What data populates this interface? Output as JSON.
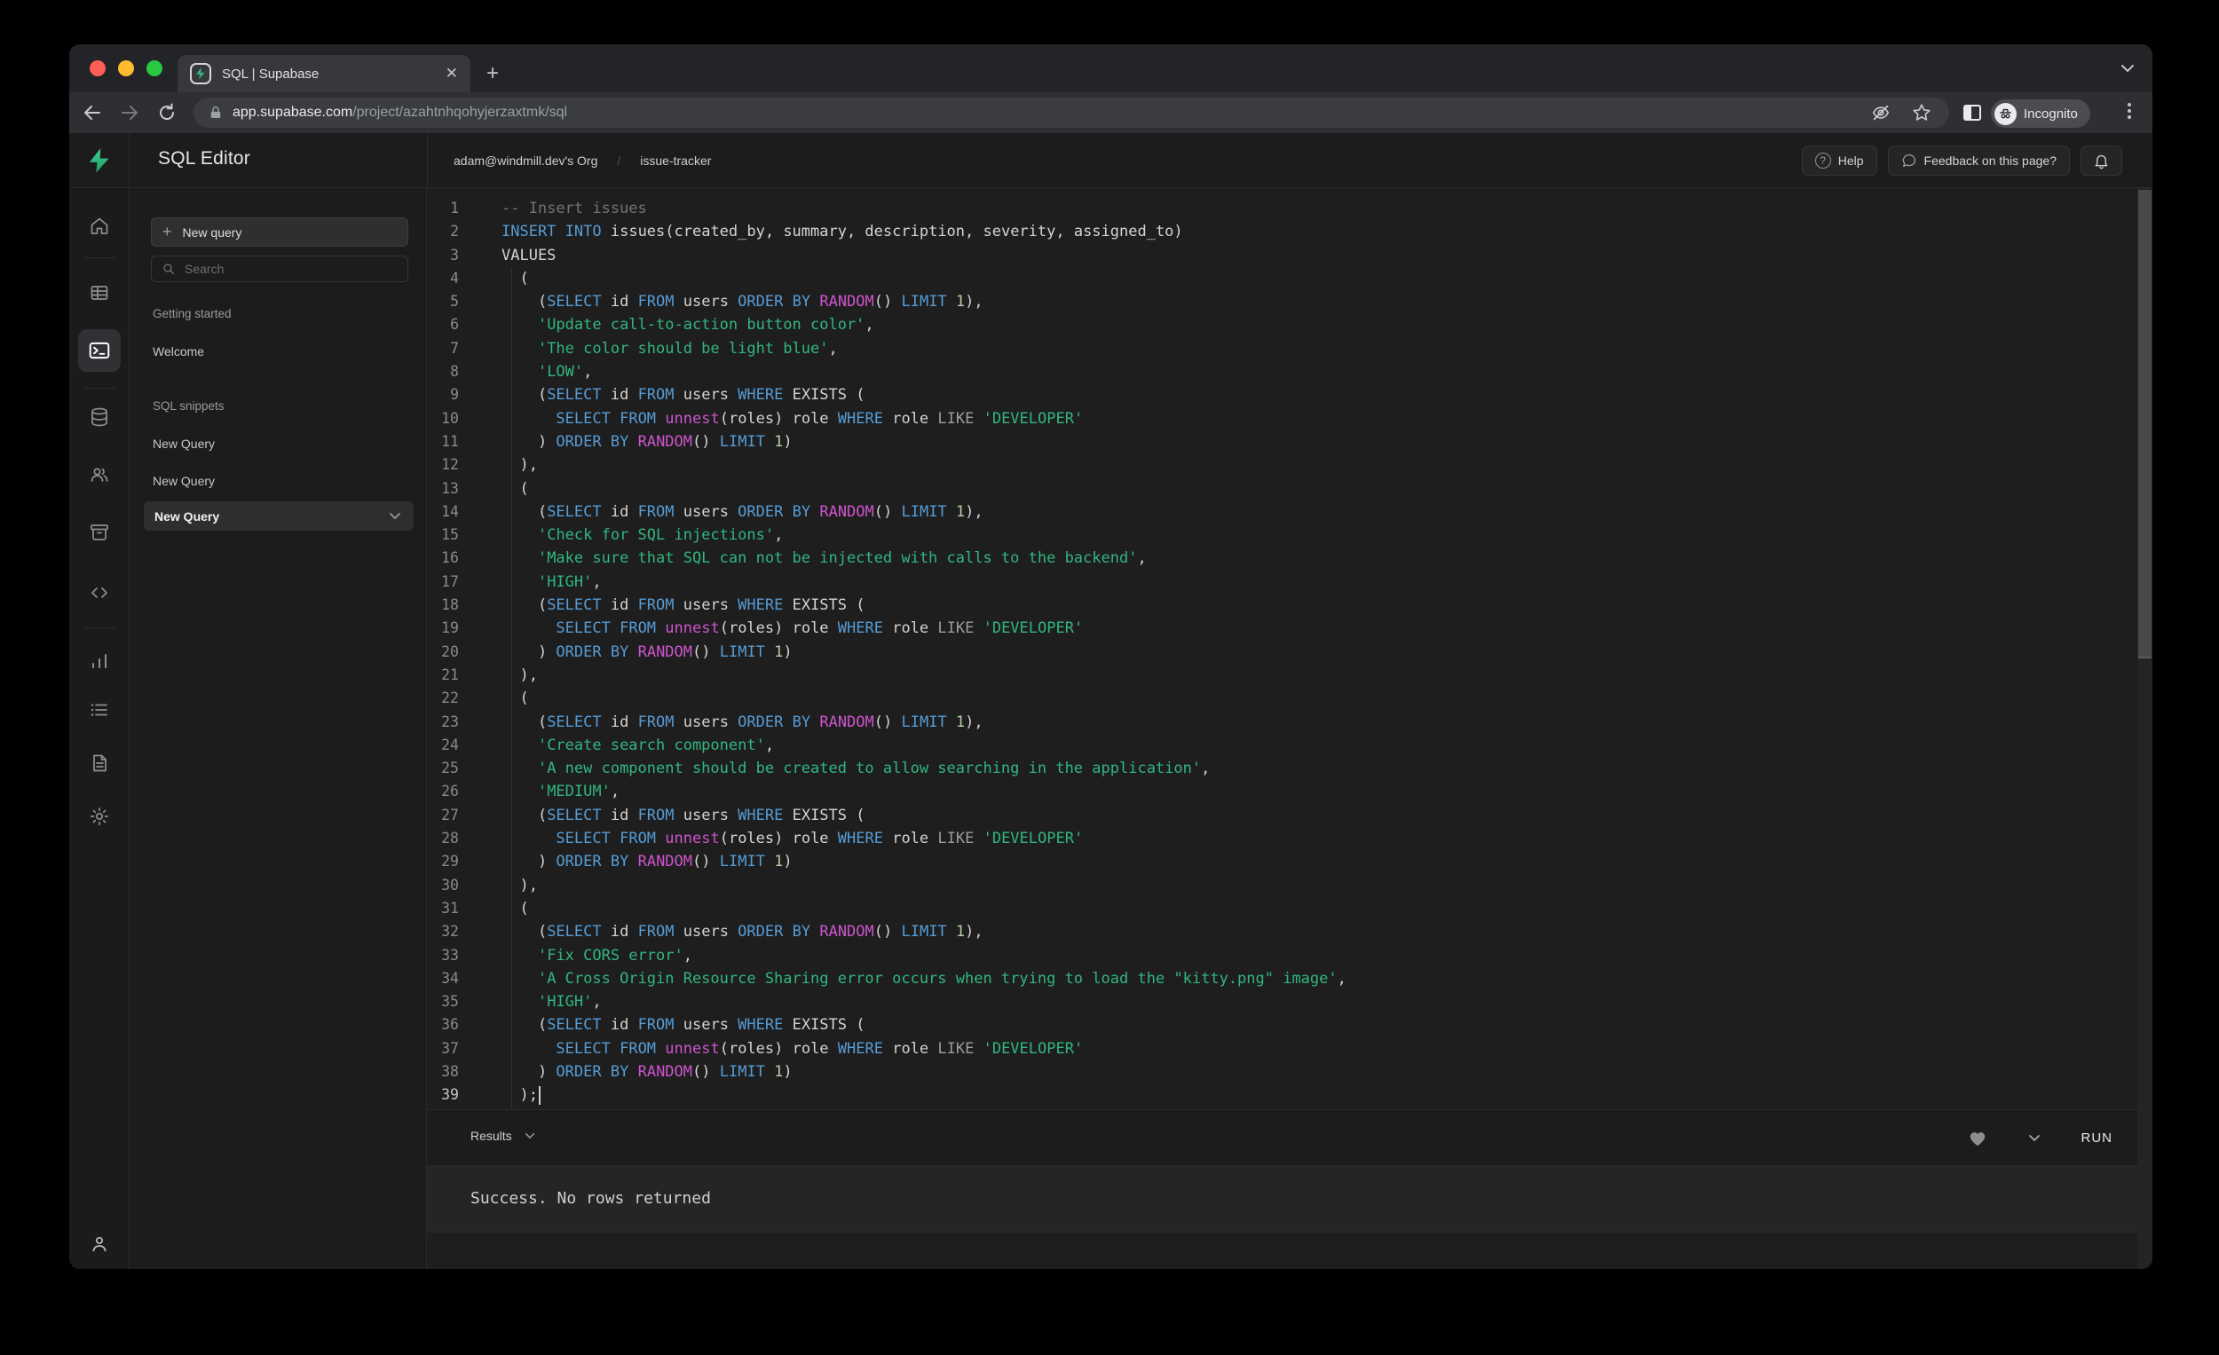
{
  "browser": {
    "tab_title": "SQL | Supabase",
    "url_host": "app.supabase.com",
    "url_path": "/project/azahtnhqohyjerzaxtmk/sql",
    "incognito_label": "Incognito"
  },
  "header": {
    "app_title": "SQL Editor",
    "breadcrumb": {
      "org": "adam@windmill.dev's Org",
      "separator": "/",
      "project": "issue-tracker"
    },
    "help_label": "Help",
    "help_icon_glyph": "?",
    "feedback_label": "Feedback on this page?"
  },
  "rail_icons": [
    "home",
    "table-editor",
    "sql-editor",
    "database",
    "auth",
    "storage",
    "edge-functions",
    "reports",
    "logs",
    "docs",
    "settings",
    "account"
  ],
  "sidebar": {
    "new_query_button": "New query",
    "new_query_plus": "+",
    "search_placeholder": "Search",
    "sections": [
      {
        "label": "Getting started",
        "items": [
          {
            "label": "Welcome",
            "selected": false
          }
        ]
      },
      {
        "label": "SQL snippets",
        "items": [
          {
            "label": "New Query",
            "selected": false
          },
          {
            "label": "New Query",
            "selected": false
          },
          {
            "label": "New Query",
            "selected": true
          }
        ]
      }
    ]
  },
  "editor": {
    "lines": [
      {
        "n": 1,
        "segs": [
          [
            "com",
            "-- Insert issues"
          ]
        ]
      },
      {
        "n": 2,
        "segs": [
          [
            "kw",
            "INSERT"
          ],
          [
            "txt",
            " "
          ],
          [
            "kw",
            "INTO"
          ],
          [
            "txt",
            " issues(created_by, summary, description, severity, assigned_to)"
          ]
        ]
      },
      {
        "n": 3,
        "segs": [
          [
            "txt",
            "VALUES"
          ]
        ]
      },
      {
        "n": 4,
        "segs": [
          [
            "txt",
            "  ("
          ]
        ]
      },
      {
        "n": 5,
        "segs": [
          [
            "txt",
            "    ("
          ],
          [
            "kw",
            "SELECT"
          ],
          [
            "txt",
            " id "
          ],
          [
            "kw",
            "FROM"
          ],
          [
            "txt",
            " users "
          ],
          [
            "kw",
            "ORDER"
          ],
          [
            "txt",
            " "
          ],
          [
            "kw",
            "BY"
          ],
          [
            "txt",
            " "
          ],
          [
            "fn",
            "RANDOM"
          ],
          [
            "txt",
            "() "
          ],
          [
            "kw",
            "LIMIT"
          ],
          [
            "txt",
            " "
          ],
          [
            "num",
            "1"
          ],
          [
            "txt",
            "),"
          ]
        ]
      },
      {
        "n": 6,
        "segs": [
          [
            "txt",
            "    "
          ],
          [
            "str",
            "'Update call-to-action button color'"
          ],
          [
            "txt",
            ","
          ]
        ]
      },
      {
        "n": 7,
        "segs": [
          [
            "txt",
            "    "
          ],
          [
            "str",
            "'The color should be light blue'"
          ],
          [
            "txt",
            ","
          ]
        ]
      },
      {
        "n": 8,
        "segs": [
          [
            "txt",
            "    "
          ],
          [
            "str",
            "'LOW'"
          ],
          [
            "txt",
            ","
          ]
        ]
      },
      {
        "n": 9,
        "segs": [
          [
            "txt",
            "    ("
          ],
          [
            "kw",
            "SELECT"
          ],
          [
            "txt",
            " id "
          ],
          [
            "kw",
            "FROM"
          ],
          [
            "txt",
            " users "
          ],
          [
            "kw",
            "WHERE"
          ],
          [
            "txt",
            " EXISTS ("
          ]
        ]
      },
      {
        "n": 10,
        "segs": [
          [
            "txt",
            "      "
          ],
          [
            "kw",
            "SELECT"
          ],
          [
            "txt",
            " "
          ],
          [
            "kw",
            "FROM"
          ],
          [
            "txt",
            " "
          ],
          [
            "fn",
            "unnest"
          ],
          [
            "txt",
            "(roles) role "
          ],
          [
            "kw",
            "WHERE"
          ],
          [
            "txt",
            " role "
          ],
          [
            "op",
            "LIKE"
          ],
          [
            "txt",
            " "
          ],
          [
            "str",
            "'DEVELOPER'"
          ]
        ]
      },
      {
        "n": 11,
        "segs": [
          [
            "txt",
            "    ) "
          ],
          [
            "kw",
            "ORDER"
          ],
          [
            "txt",
            " "
          ],
          [
            "kw",
            "BY"
          ],
          [
            "txt",
            " "
          ],
          [
            "fn",
            "RANDOM"
          ],
          [
            "txt",
            "() "
          ],
          [
            "kw",
            "LIMIT"
          ],
          [
            "txt",
            " "
          ],
          [
            "num",
            "1"
          ],
          [
            "txt",
            ")"
          ]
        ]
      },
      {
        "n": 12,
        "segs": [
          [
            "txt",
            "  ),"
          ]
        ]
      },
      {
        "n": 13,
        "segs": [
          [
            "txt",
            "  ("
          ]
        ]
      },
      {
        "n": 14,
        "segs": [
          [
            "txt",
            "    ("
          ],
          [
            "kw",
            "SELECT"
          ],
          [
            "txt",
            " id "
          ],
          [
            "kw",
            "FROM"
          ],
          [
            "txt",
            " users "
          ],
          [
            "kw",
            "ORDER"
          ],
          [
            "txt",
            " "
          ],
          [
            "kw",
            "BY"
          ],
          [
            "txt",
            " "
          ],
          [
            "fn",
            "RANDOM"
          ],
          [
            "txt",
            "() "
          ],
          [
            "kw",
            "LIMIT"
          ],
          [
            "txt",
            " "
          ],
          [
            "num",
            "1"
          ],
          [
            "txt",
            "),"
          ]
        ]
      },
      {
        "n": 15,
        "segs": [
          [
            "txt",
            "    "
          ],
          [
            "str",
            "'Check for SQL injections'"
          ],
          [
            "txt",
            ","
          ]
        ]
      },
      {
        "n": 16,
        "segs": [
          [
            "txt",
            "    "
          ],
          [
            "str",
            "'Make sure that SQL can not be injected with calls to the backend'"
          ],
          [
            "txt",
            ","
          ]
        ]
      },
      {
        "n": 17,
        "segs": [
          [
            "txt",
            "    "
          ],
          [
            "str",
            "'HIGH'"
          ],
          [
            "txt",
            ","
          ]
        ]
      },
      {
        "n": 18,
        "segs": [
          [
            "txt",
            "    ("
          ],
          [
            "kw",
            "SELECT"
          ],
          [
            "txt",
            " id "
          ],
          [
            "kw",
            "FROM"
          ],
          [
            "txt",
            " users "
          ],
          [
            "kw",
            "WHERE"
          ],
          [
            "txt",
            " EXISTS ("
          ]
        ]
      },
      {
        "n": 19,
        "segs": [
          [
            "txt",
            "      "
          ],
          [
            "kw",
            "SELECT"
          ],
          [
            "txt",
            " "
          ],
          [
            "kw",
            "FROM"
          ],
          [
            "txt",
            " "
          ],
          [
            "fn",
            "unnest"
          ],
          [
            "txt",
            "(roles) role "
          ],
          [
            "kw",
            "WHERE"
          ],
          [
            "txt",
            " role "
          ],
          [
            "op",
            "LIKE"
          ],
          [
            "txt",
            " "
          ],
          [
            "str",
            "'DEVELOPER'"
          ]
        ]
      },
      {
        "n": 20,
        "segs": [
          [
            "txt",
            "    ) "
          ],
          [
            "kw",
            "ORDER"
          ],
          [
            "txt",
            " "
          ],
          [
            "kw",
            "BY"
          ],
          [
            "txt",
            " "
          ],
          [
            "fn",
            "RANDOM"
          ],
          [
            "txt",
            "() "
          ],
          [
            "kw",
            "LIMIT"
          ],
          [
            "txt",
            " "
          ],
          [
            "num",
            "1"
          ],
          [
            "txt",
            ")"
          ]
        ]
      },
      {
        "n": 21,
        "segs": [
          [
            "txt",
            "  ),"
          ]
        ]
      },
      {
        "n": 22,
        "segs": [
          [
            "txt",
            "  ("
          ]
        ]
      },
      {
        "n": 23,
        "segs": [
          [
            "txt",
            "    ("
          ],
          [
            "kw",
            "SELECT"
          ],
          [
            "txt",
            " id "
          ],
          [
            "kw",
            "FROM"
          ],
          [
            "txt",
            " users "
          ],
          [
            "kw",
            "ORDER"
          ],
          [
            "txt",
            " "
          ],
          [
            "kw",
            "BY"
          ],
          [
            "txt",
            " "
          ],
          [
            "fn",
            "RANDOM"
          ],
          [
            "txt",
            "() "
          ],
          [
            "kw",
            "LIMIT"
          ],
          [
            "txt",
            " "
          ],
          [
            "num",
            "1"
          ],
          [
            "txt",
            "),"
          ]
        ]
      },
      {
        "n": 24,
        "segs": [
          [
            "txt",
            "    "
          ],
          [
            "str",
            "'Create search component'"
          ],
          [
            "txt",
            ","
          ]
        ]
      },
      {
        "n": 25,
        "segs": [
          [
            "txt",
            "    "
          ],
          [
            "str",
            "'A new component should be created to allow searching in the application'"
          ],
          [
            "txt",
            ","
          ]
        ]
      },
      {
        "n": 26,
        "segs": [
          [
            "txt",
            "    "
          ],
          [
            "str",
            "'MEDIUM'"
          ],
          [
            "txt",
            ","
          ]
        ]
      },
      {
        "n": 27,
        "segs": [
          [
            "txt",
            "    ("
          ],
          [
            "kw",
            "SELECT"
          ],
          [
            "txt",
            " id "
          ],
          [
            "kw",
            "FROM"
          ],
          [
            "txt",
            " users "
          ],
          [
            "kw",
            "WHERE"
          ],
          [
            "txt",
            " EXISTS ("
          ]
        ]
      },
      {
        "n": 28,
        "segs": [
          [
            "txt",
            "      "
          ],
          [
            "kw",
            "SELECT"
          ],
          [
            "txt",
            " "
          ],
          [
            "kw",
            "FROM"
          ],
          [
            "txt",
            " "
          ],
          [
            "fn",
            "unnest"
          ],
          [
            "txt",
            "(roles) role "
          ],
          [
            "kw",
            "WHERE"
          ],
          [
            "txt",
            " role "
          ],
          [
            "op",
            "LIKE"
          ],
          [
            "txt",
            " "
          ],
          [
            "str",
            "'DEVELOPER'"
          ]
        ]
      },
      {
        "n": 29,
        "segs": [
          [
            "txt",
            "    ) "
          ],
          [
            "kw",
            "ORDER"
          ],
          [
            "txt",
            " "
          ],
          [
            "kw",
            "BY"
          ],
          [
            "txt",
            " "
          ],
          [
            "fn",
            "RANDOM"
          ],
          [
            "txt",
            "() "
          ],
          [
            "kw",
            "LIMIT"
          ],
          [
            "txt",
            " "
          ],
          [
            "num",
            "1"
          ],
          [
            "txt",
            ")"
          ]
        ]
      },
      {
        "n": 30,
        "segs": [
          [
            "txt",
            "  ),"
          ]
        ]
      },
      {
        "n": 31,
        "segs": [
          [
            "txt",
            "  ("
          ]
        ]
      },
      {
        "n": 32,
        "segs": [
          [
            "txt",
            "    ("
          ],
          [
            "kw",
            "SELECT"
          ],
          [
            "txt",
            " id "
          ],
          [
            "kw",
            "FROM"
          ],
          [
            "txt",
            " users "
          ],
          [
            "kw",
            "ORDER"
          ],
          [
            "txt",
            " "
          ],
          [
            "kw",
            "BY"
          ],
          [
            "txt",
            " "
          ],
          [
            "fn",
            "RANDOM"
          ],
          [
            "txt",
            "() "
          ],
          [
            "kw",
            "LIMIT"
          ],
          [
            "txt",
            " "
          ],
          [
            "num",
            "1"
          ],
          [
            "txt",
            "),"
          ]
        ]
      },
      {
        "n": 33,
        "segs": [
          [
            "txt",
            "    "
          ],
          [
            "str",
            "'Fix CORS error'"
          ],
          [
            "txt",
            ","
          ]
        ]
      },
      {
        "n": 34,
        "segs": [
          [
            "txt",
            "    "
          ],
          [
            "str",
            "'A Cross Origin Resource Sharing error occurs when trying to load the \"kitty.png\" image'"
          ],
          [
            "txt",
            ","
          ]
        ]
      },
      {
        "n": 35,
        "segs": [
          [
            "txt",
            "    "
          ],
          [
            "str",
            "'HIGH'"
          ],
          [
            "txt",
            ","
          ]
        ]
      },
      {
        "n": 36,
        "segs": [
          [
            "txt",
            "    ("
          ],
          [
            "kw",
            "SELECT"
          ],
          [
            "txt",
            " id "
          ],
          [
            "kw",
            "FROM"
          ],
          [
            "txt",
            " users "
          ],
          [
            "kw",
            "WHERE"
          ],
          [
            "txt",
            " EXISTS ("
          ]
        ]
      },
      {
        "n": 37,
        "segs": [
          [
            "txt",
            "      "
          ],
          [
            "kw",
            "SELECT"
          ],
          [
            "txt",
            " "
          ],
          [
            "kw",
            "FROM"
          ],
          [
            "txt",
            " "
          ],
          [
            "fn",
            "unnest"
          ],
          [
            "txt",
            "(roles) role "
          ],
          [
            "kw",
            "WHERE"
          ],
          [
            "txt",
            " role "
          ],
          [
            "op",
            "LIKE"
          ],
          [
            "txt",
            " "
          ],
          [
            "str",
            "'DEVELOPER'"
          ]
        ]
      },
      {
        "n": 38,
        "segs": [
          [
            "txt",
            "    ) "
          ],
          [
            "kw",
            "ORDER"
          ],
          [
            "txt",
            " "
          ],
          [
            "kw",
            "BY"
          ],
          [
            "txt",
            " "
          ],
          [
            "fn",
            "RANDOM"
          ],
          [
            "txt",
            "() "
          ],
          [
            "kw",
            "LIMIT"
          ],
          [
            "txt",
            " "
          ],
          [
            "num",
            "1"
          ],
          [
            "txt",
            ")"
          ]
        ]
      },
      {
        "n": 39,
        "segs": [
          [
            "txt",
            "  );"
          ]
        ],
        "caret": true,
        "active": true
      }
    ]
  },
  "results": {
    "label": "Results",
    "run_label": "RUN",
    "message": "Success. No rows returned"
  },
  "colors": {
    "accent_green": "#3ecf8e",
    "keyword": "#569cd6",
    "function": "#ce54ce",
    "string": "#31b681",
    "comment": "#737373",
    "operator": "#9d9d9d",
    "number": "#b5cea8",
    "traffic_red": "#ff5f57",
    "traffic_yellow": "#febc2e",
    "traffic_green": "#28c840"
  }
}
